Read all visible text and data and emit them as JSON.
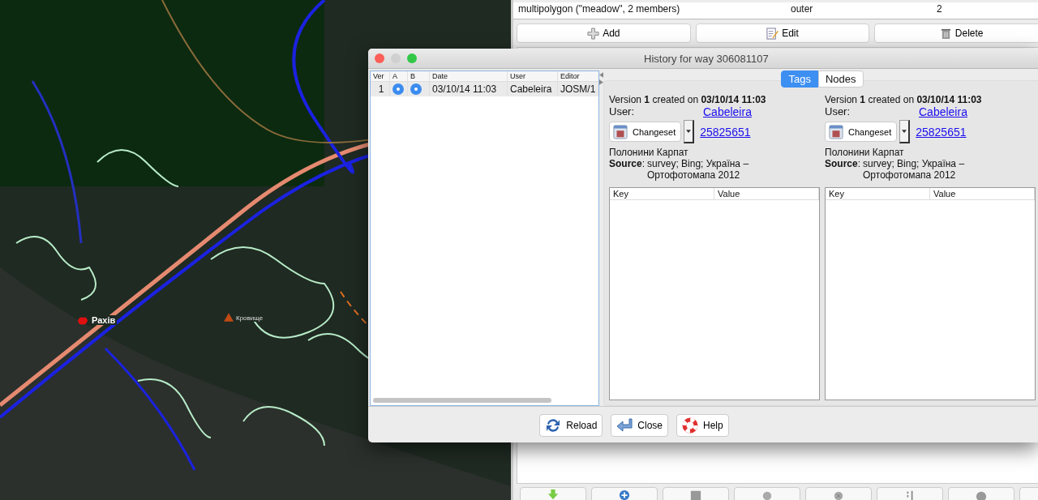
{
  "map": {
    "labels": [
      {
        "text": "Рахів",
        "kind": "town"
      },
      {
        "text": "Кровище",
        "kind": "peak"
      }
    ]
  },
  "relations": {
    "rows": [
      {
        "relation": "multipolygon (\"meadow\", 2 members)",
        "role": "outer",
        "count": "2"
      }
    ],
    "buttons": [
      {
        "label": "Add",
        "kind": "add"
      },
      {
        "label": "Edit",
        "kind": "edit"
      },
      {
        "label": "Delete",
        "kind": "delete"
      }
    ]
  },
  "dialog": {
    "title": "History for way 306081107",
    "versions": {
      "columns": [
        "Ver",
        "A",
        "B",
        "Date",
        "User",
        "Editor"
      ],
      "rows": [
        {
          "ver": "1",
          "a_selected": true,
          "b_selected": true,
          "date": "03/10/14 11:03",
          "user": "Cabeleira",
          "editor": "JOSM/1"
        }
      ]
    },
    "tabs": [
      {
        "label": "Tags",
        "selected": true
      },
      {
        "label": "Nodes",
        "selected": false
      }
    ],
    "panes": [
      {
        "version_text": "Version **1** created on **03/10/14 11:03**",
        "user_label": "User:",
        "user": "Cabeleira",
        "changeset_button": "Changeset",
        "changeset": "25825651",
        "comment": "Полонини Карпат",
        "source_label": "**Source**:",
        "source": "survey; Bing; Україна – Ортофотомапа 2012",
        "columns": [
          "Key",
          "Value"
        ]
      },
      {
        "version_text": "Version **1** created on **03/10/14 11:03**",
        "user_label": "User:",
        "user": "Cabeleira",
        "changeset_button": "Changeset",
        "changeset": "25825651",
        "comment": "Полонини Карпат",
        "source_label": "**Source**:",
        "source": "survey; Bing; Україна – Ортофотомапа 2012",
        "columns": [
          "Key",
          "Value"
        ]
      }
    ],
    "buttons": [
      {
        "label": "Reload",
        "kind": "reload"
      },
      {
        "label": "Close",
        "kind": "close"
      },
      {
        "label": "Help",
        "kind": "help"
      }
    ]
  }
}
